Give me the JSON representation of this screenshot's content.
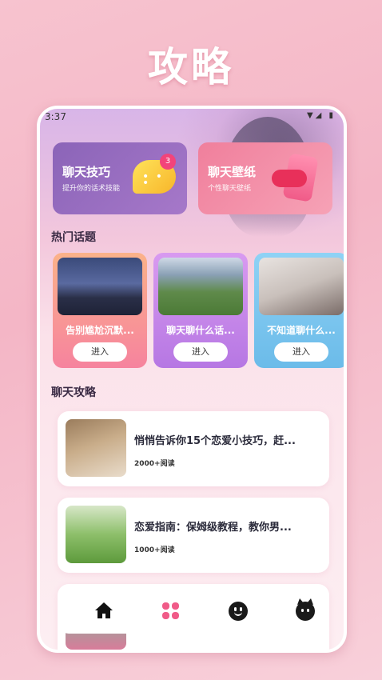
{
  "promo": {
    "title": "攻略"
  },
  "status": {
    "time": "3:37",
    "icons": "▼◢ ▮"
  },
  "features": [
    {
      "title": "聊天技巧",
      "subtitle": "提升你的话术技能",
      "badge": "3",
      "icon": "chat-bubble-icon"
    },
    {
      "title": "聊天壁纸",
      "subtitle": "个性聊天壁纸",
      "icon": "phone-lips-icon"
    }
  ],
  "hot": {
    "title": "热门话题",
    "topics": [
      {
        "name": "告别尴尬沉默...",
        "button": "进入"
      },
      {
        "name": "聊天聊什么话...",
        "button": "进入"
      },
      {
        "name": "不知道聊什么...",
        "button": "进入"
      }
    ]
  },
  "guide": {
    "title": "聊天攻略",
    "articles": [
      {
        "title": "悄悄告诉你15个恋爱小技巧，赶...",
        "reads": "2000+阅读"
      },
      {
        "title": "恋爱指南：保姆级教程，教你男...",
        "reads": "1000+阅读"
      },
      {
        "title": "",
        "reads": ""
      }
    ]
  },
  "tabbar": {
    "items": [
      "home-icon",
      "grid-icon",
      "smile-icon",
      "cat-face-icon"
    ],
    "active_color": "#f05b88"
  }
}
